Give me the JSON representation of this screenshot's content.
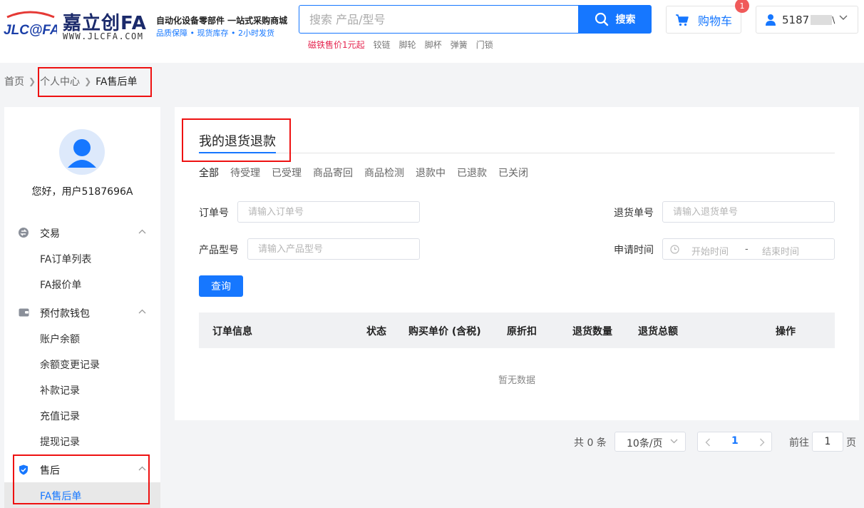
{
  "header": {
    "logo_mark": "JLC@FA",
    "logo_brand": "嘉立创FA",
    "logo_url": "WWW.JLCFA.COM",
    "slogan": "自动化设备零部件 一站式采购商城",
    "slogan_sub": "品质保障 • 现货库存 • 2小时发货",
    "search_placeholder": "搜索 产品/型号",
    "search_button": "搜索",
    "hot_words": [
      "磁铁售价1元起",
      "铰链",
      "脚轮",
      "脚杯",
      "弹簧",
      "门锁"
    ],
    "cart_label": "购物车",
    "cart_badge": "1",
    "user_label": "5187",
    "user_label_tail": "\\"
  },
  "breadcrumb": {
    "home": "首页",
    "center": "个人中心",
    "current": "FA售后单"
  },
  "sidebar": {
    "greeting": "您好，用户5187696A",
    "groups": [
      {
        "label": "交易",
        "items": [
          "FA订单列表",
          "FA报价单"
        ]
      },
      {
        "label": "预付款钱包",
        "items": [
          "账户余额",
          "余额变更记录",
          "补款记录",
          "充值记录",
          "提现记录"
        ]
      },
      {
        "label": "售后",
        "items": [
          "FA售后单"
        ]
      }
    ]
  },
  "main": {
    "title": "我的退货退款",
    "filters": [
      "全部",
      "待受理",
      "已受理",
      "商品寄回",
      "商品检测",
      "退款中",
      "已退款",
      "已关闭"
    ],
    "form": {
      "order_no_label": "订单号",
      "order_no_placeholder": "请输入订单号",
      "return_no_label": "退货单号",
      "return_no_placeholder": "请输入退货单号",
      "model_label": "产品型号",
      "model_placeholder": "请输入产品型号",
      "date_label": "申请时间",
      "date_start": "开始时间",
      "date_sep": "-",
      "date_end": "结束时间",
      "query_button": "查询"
    },
    "table": {
      "columns": [
        "订单信息",
        "状态",
        "购买单价 (含税)",
        "原折扣",
        "退货数量",
        "退货总额",
        "操作"
      ],
      "empty": "暂无数据"
    }
  },
  "pagination": {
    "total": "共 0 条",
    "page_size": "10条/页",
    "current_page": "1",
    "goto_prefix": "前往",
    "goto_value": "1",
    "goto_suffix": "页"
  },
  "colors": {
    "accent": "#1677ff",
    "highlight": "#ee1111",
    "badge": "#f05a5a"
  }
}
